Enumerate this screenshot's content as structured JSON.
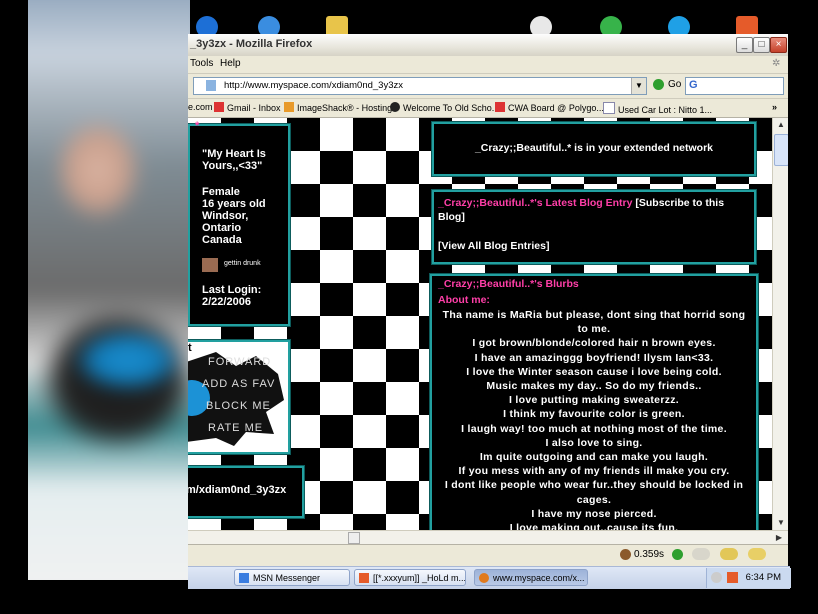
{
  "window": {
    "title": "_3y3zx - Mozilla Firefox",
    "menu": [
      "Tools",
      "Help"
    ],
    "url": "http://www.myspace.com/xdiam0nd_3y3zx",
    "go_label": "Go",
    "search_logo": "G"
  },
  "bookmarks": [
    {
      "label": "e.com",
      "icon": "page-icon"
    },
    {
      "label": "Gmail - Inbox",
      "icon": "gmail-icon"
    },
    {
      "label": "ImageShack® - Hosting",
      "icon": "imageshack-icon"
    },
    {
      "label": "Welcome To Old Scho...",
      "icon": "skull-icon"
    },
    {
      "label": "CWA Board @ Polygo...",
      "icon": "gmail-icon"
    },
    {
      "label": "Used Car Lot : Nitto 1...",
      "icon": "page-icon"
    }
  ],
  "profile": {
    "name_fragment": "*",
    "quote": "\"My Heart Is Yours,,<33\"",
    "gender": "Female",
    "age": "16 years old",
    "city": "Windsor,",
    "province": "Ontario",
    "country": "Canada",
    "mood": "gettin drunk",
    "last_login_label": "Last Login:",
    "last_login": "2/22/2006"
  },
  "contact": {
    "fragment": "t",
    "items": [
      "FORWARD",
      "ADD AS FAV",
      "BLOCK ME",
      "RATE ME"
    ]
  },
  "url_box": "m/xdiam0nd_3y3zx",
  "network": {
    "text": "_Crazy;;Beautiful..* is in your extended network"
  },
  "blog": {
    "title_pink": "_Crazy;;Beautiful..*'s Latest Blog Entry",
    "subscribe": "[Subscribe to this Blog]",
    "view_all": "[View All Blog Entries]"
  },
  "blurbs": {
    "title": "_Crazy;;Beautiful..*'s Blurbs",
    "about_label": "About me:",
    "lines": [
      "Tha name is MaRia but please, dont sing that horrid song to me.",
      "I got brown/blonde/colored hair n brown eyes.",
      "I have an amazinggg boyfriend! Ilysm Ian<33.",
      "I love the Winter season cause i love being cold.",
      "Music makes my day.. So do my friends..",
      "I love putting making sweaterzz.",
      "I think my favourite color is green.",
      "I laugh way! too much at nothing most of the time.",
      "I also love to sing.",
      "Im quite outgoing and can make you laugh.",
      "If you mess with any of my friends ill make you cry.",
      "I dont like people who wear fur..they should be locked in cages.",
      "I have my nose pierced.",
      "I love making out..cause its fun."
    ]
  },
  "status": {
    "load_time": "0.359s"
  },
  "taskbar": {
    "tasks": [
      "MSN Messenger",
      "[[*.xxxyum]] _HoLd m...",
      "www.myspace.com/x..."
    ],
    "clock": "6:34 PM"
  },
  "colors": {
    "accent_pink": "#ff3fa8",
    "panel_border": "#22a0a0",
    "firefox_chrome": "#ece9d8"
  }
}
